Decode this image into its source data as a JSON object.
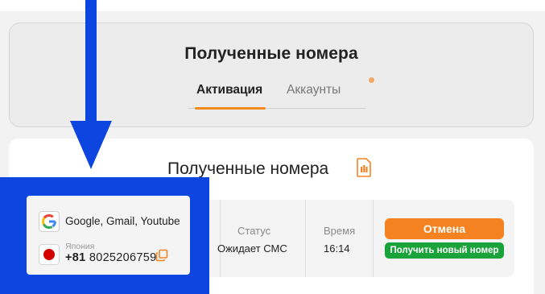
{
  "header": {
    "title": "Полученные номера",
    "tabs": [
      {
        "label": "Активация",
        "active": true
      },
      {
        "label": "Аккаунты",
        "active": false
      }
    ]
  },
  "content": {
    "title": "Полученные номера",
    "row": {
      "service": "Google, Gmail, Youtube",
      "country": "Япония",
      "phone_code": "+81",
      "phone_number": "8025206759",
      "status_label": "Статус",
      "status_value": "Ожидает СМС",
      "time_label": "Время",
      "time_value": "16:14",
      "cancel_label": "Отмена",
      "new_number_label": "Получить новый номер"
    }
  },
  "icons": {
    "service": "google-icon",
    "flag": "japan-flag-icon",
    "copy": "copy-icon",
    "sim": "sim-card-icon",
    "annotation": "arrow-down-icon"
  },
  "colors": {
    "accent": "#f58220",
    "success": "#1aa33a",
    "annotation": "#0c45e0"
  }
}
